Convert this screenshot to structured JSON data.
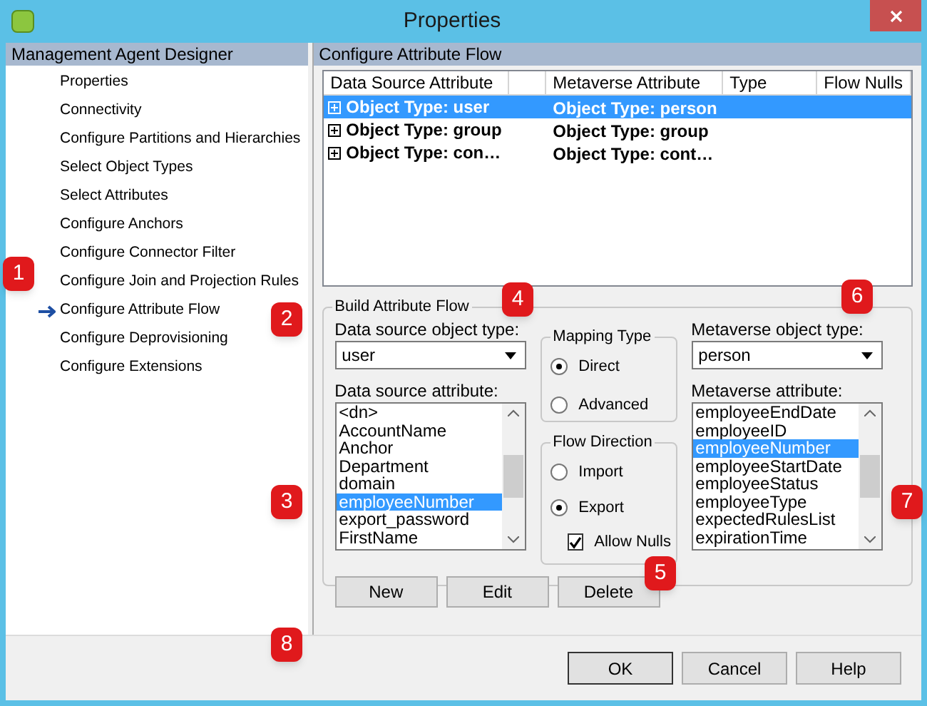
{
  "window": {
    "title": "Properties"
  },
  "sidebar": {
    "title": "Management Agent Designer",
    "items": [
      {
        "label": "Properties",
        "selected": false
      },
      {
        "label": "Connectivity",
        "selected": false
      },
      {
        "label": "Configure Partitions and Hierarchies",
        "selected": false
      },
      {
        "label": "Select Object Types",
        "selected": false
      },
      {
        "label": "Select Attributes",
        "selected": false
      },
      {
        "label": "Configure Anchors",
        "selected": false
      },
      {
        "label": "Configure Connector Filter",
        "selected": false
      },
      {
        "label": "Configure Join and Projection Rules",
        "selected": false
      },
      {
        "label": "Configure Attribute Flow",
        "selected": true
      },
      {
        "label": "Configure Deprovisioning",
        "selected": false
      },
      {
        "label": "Configure Extensions",
        "selected": false
      }
    ]
  },
  "panel": {
    "title": "Configure Attribute Flow"
  },
  "table": {
    "columns": [
      "Data Source Attribute",
      "Metaverse Attribute",
      "Type",
      "Flow Nulls"
    ],
    "rows": [
      {
        "data_source": "Object Type: user",
        "metaverse": "Object Type: person",
        "selected": true
      },
      {
        "data_source": "Object Type: group",
        "metaverse": "Object Type: group",
        "selected": false
      },
      {
        "data_source": "Object Type: con…",
        "metaverse": "Object Type: cont…",
        "selected": false
      }
    ]
  },
  "build": {
    "title": "Build Attribute Flow",
    "source_type": {
      "label": "Data source object type:",
      "value": "user"
    },
    "source_attribute": {
      "label": "Data source attribute:",
      "items": [
        {
          "label": "<dn>",
          "selected": false
        },
        {
          "label": "AccountName",
          "selected": false
        },
        {
          "label": "Anchor",
          "selected": false
        },
        {
          "label": "Department",
          "selected": false
        },
        {
          "label": "domain",
          "selected": false
        },
        {
          "label": "employeeNumber",
          "selected": true
        },
        {
          "label": "export_password",
          "selected": false
        },
        {
          "label": "FirstName",
          "selected": false
        }
      ]
    },
    "mapping_type": {
      "title": "Mapping Type",
      "options": [
        {
          "label": "Direct",
          "selected": true
        },
        {
          "label": "Advanced",
          "selected": false
        }
      ]
    },
    "flow_direction": {
      "title": "Flow Direction",
      "options": [
        {
          "label": "Import",
          "selected": false
        },
        {
          "label": "Export",
          "selected": true
        }
      ],
      "allow_nulls": {
        "label": "Allow Nulls",
        "checked": true
      }
    },
    "metaverse_type": {
      "label": "Metaverse object type:",
      "value": "person"
    },
    "metaverse_attribute": {
      "label": "Metaverse attribute:",
      "items": [
        {
          "label": "employeeEndDate",
          "selected": false
        },
        {
          "label": "employeeID",
          "selected": false
        },
        {
          "label": "employeeNumber",
          "selected": true
        },
        {
          "label": "employeeStartDate",
          "selected": false
        },
        {
          "label": "employeeStatus",
          "selected": false
        },
        {
          "label": "employeeType",
          "selected": false
        },
        {
          "label": "expectedRulesList",
          "selected": false
        },
        {
          "label": "expirationTime",
          "selected": false
        }
      ]
    },
    "buttons": [
      "New",
      "Edit",
      "Delete"
    ]
  },
  "footer_buttons": [
    "OK",
    "Cancel",
    "Help"
  ],
  "callouts": [
    "1",
    "2",
    "3",
    "4",
    "5",
    "6",
    "7",
    "8"
  ]
}
